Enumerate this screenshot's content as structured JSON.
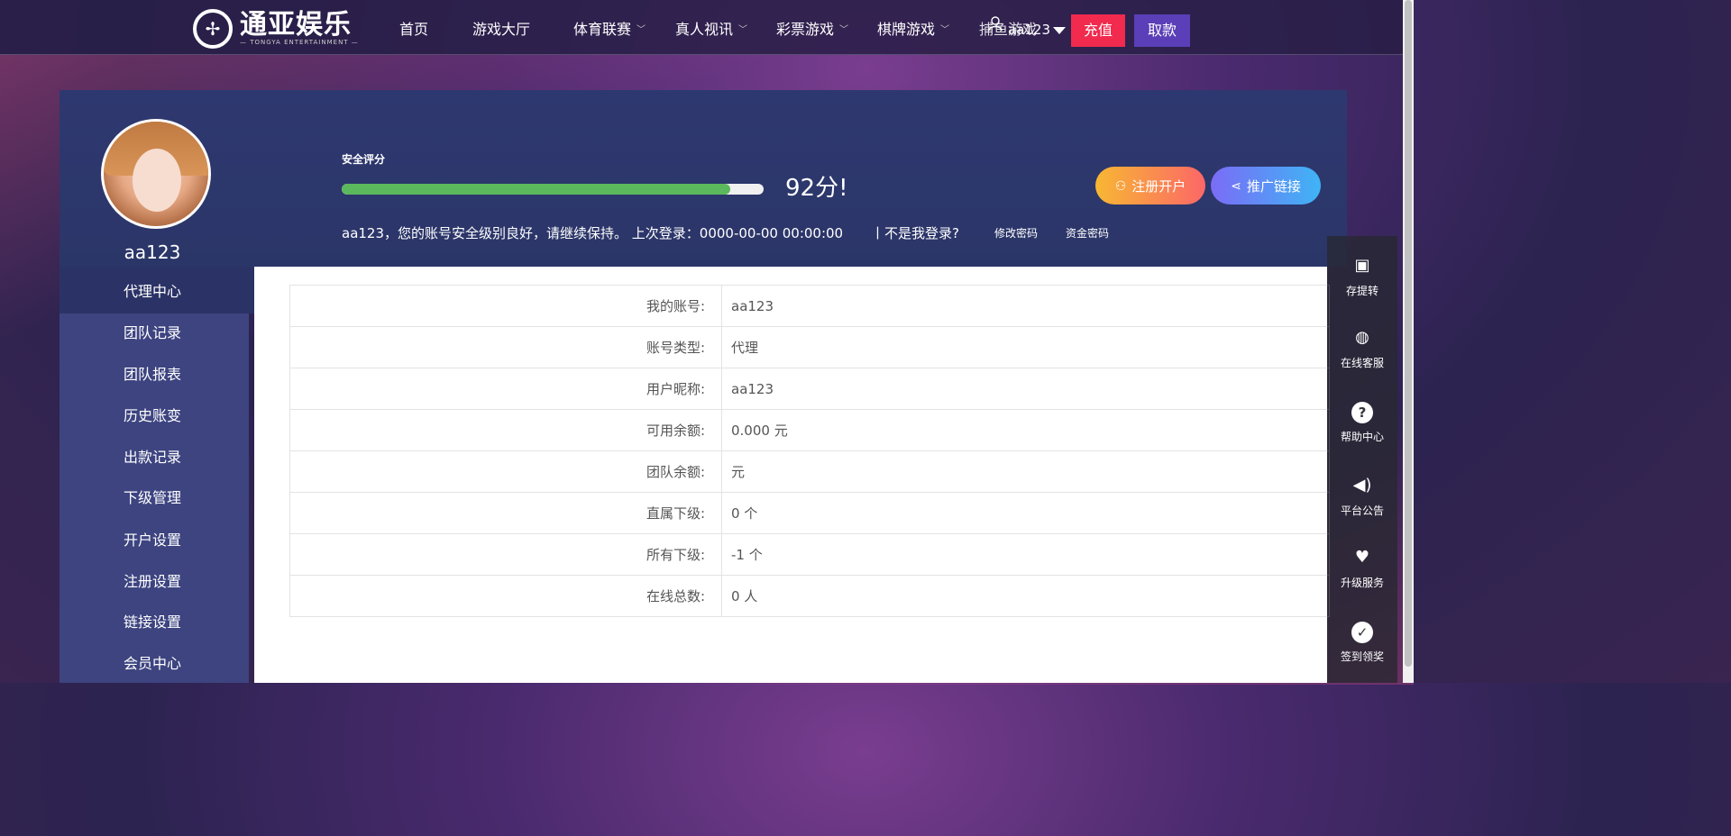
{
  "nav": {
    "logo_cn": "通亚娱乐",
    "logo_en": "— TONGYA ENTERTAINMENT —",
    "items": [
      {
        "label": "首页",
        "dropdown": false
      },
      {
        "label": "游戏大厅",
        "dropdown": false
      },
      {
        "label": "体育联赛",
        "dropdown": true
      },
      {
        "label": "真人视讯",
        "dropdown": true
      },
      {
        "label": "彩票游戏",
        "dropdown": true
      },
      {
        "label": "棋牌游戏",
        "dropdown": true
      },
      {
        "label": "捕鱼游戏",
        "dropdown": false
      }
    ],
    "username": "aa123",
    "deposit_label": "充值",
    "withdraw_label": "取款"
  },
  "profile": {
    "username": "aa123",
    "score_label": "安全评分",
    "score_percent": 92,
    "score_text": "92分!",
    "status_text": "aa123，您的账号安全级别良好，请继续保持。 上次登录：0000-00-00 00:00:00",
    "not_me": "丨不是我登录?",
    "change_password": "修改密码",
    "fund_password": "资金密码",
    "register_button": "注册开户",
    "promo_button": "推广链接"
  },
  "sidebar": {
    "header": "代理中心",
    "items": [
      "团队记录",
      "团队报表",
      "历史账变",
      "出款记录",
      "下级管理",
      "开户设置",
      "注册设置",
      "链接设置",
      "会员中心"
    ]
  },
  "account_info": [
    {
      "key": "我的账号:",
      "value": "aa123"
    },
    {
      "key": "账号类型:",
      "value": "代理"
    },
    {
      "key": "用户昵称:",
      "value": "aa123"
    },
    {
      "key": "可用余额:",
      "value": "0.000 元"
    },
    {
      "key": "团队余额:",
      "value": "元"
    },
    {
      "key": "直属下级:",
      "value": "0 个"
    },
    {
      "key": "所有下级:",
      "value": "-1 个"
    },
    {
      "key": "在线总数:",
      "value": "0 人"
    }
  ],
  "rail": [
    {
      "label": "存提转",
      "icon": "wallet-icon"
    },
    {
      "label": "在线客服",
      "icon": "headset-icon"
    },
    {
      "label": "帮助中心",
      "icon": "help-icon"
    },
    {
      "label": "平台公告",
      "icon": "speaker-icon"
    },
    {
      "label": "升级服务",
      "icon": "heart-pulse-icon"
    },
    {
      "label": "签到领奖",
      "icon": "check-circle-icon"
    }
  ]
}
